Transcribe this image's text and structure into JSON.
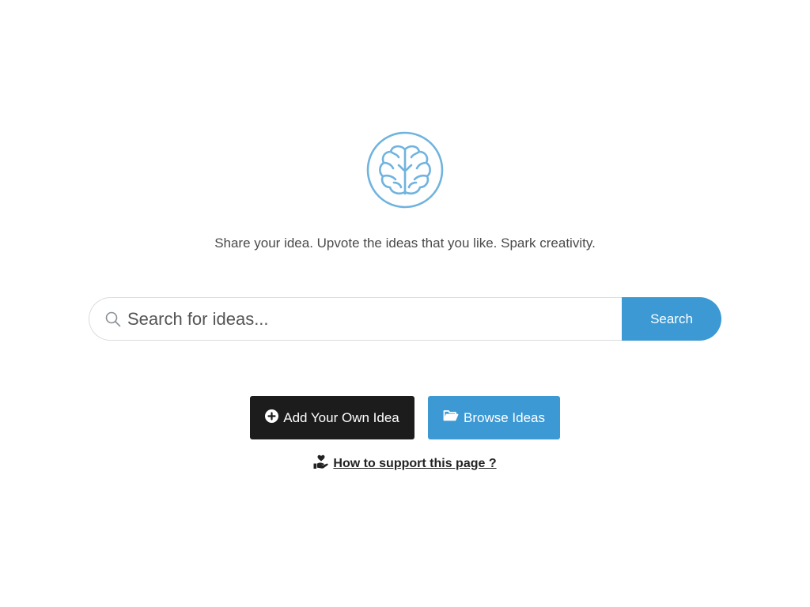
{
  "brand": {
    "logo_icon": "brain-icon",
    "accent_color": "#3c99d4",
    "dark_color": "#1c1c1c"
  },
  "tagline": "Share your idea. Upvote the ideas that you like. Spark creativity.",
  "search": {
    "icon": "search-icon",
    "placeholder": "Search for ideas...",
    "value": "",
    "button_label": "Search"
  },
  "actions": {
    "add": {
      "icon": "plus-circle-icon",
      "label": "Add Your Own Idea"
    },
    "browse": {
      "icon": "folder-open-icon",
      "label": "Browse Ideas"
    }
  },
  "support": {
    "icon": "hand-holding-heart-icon",
    "label": "How to support this page ?"
  }
}
